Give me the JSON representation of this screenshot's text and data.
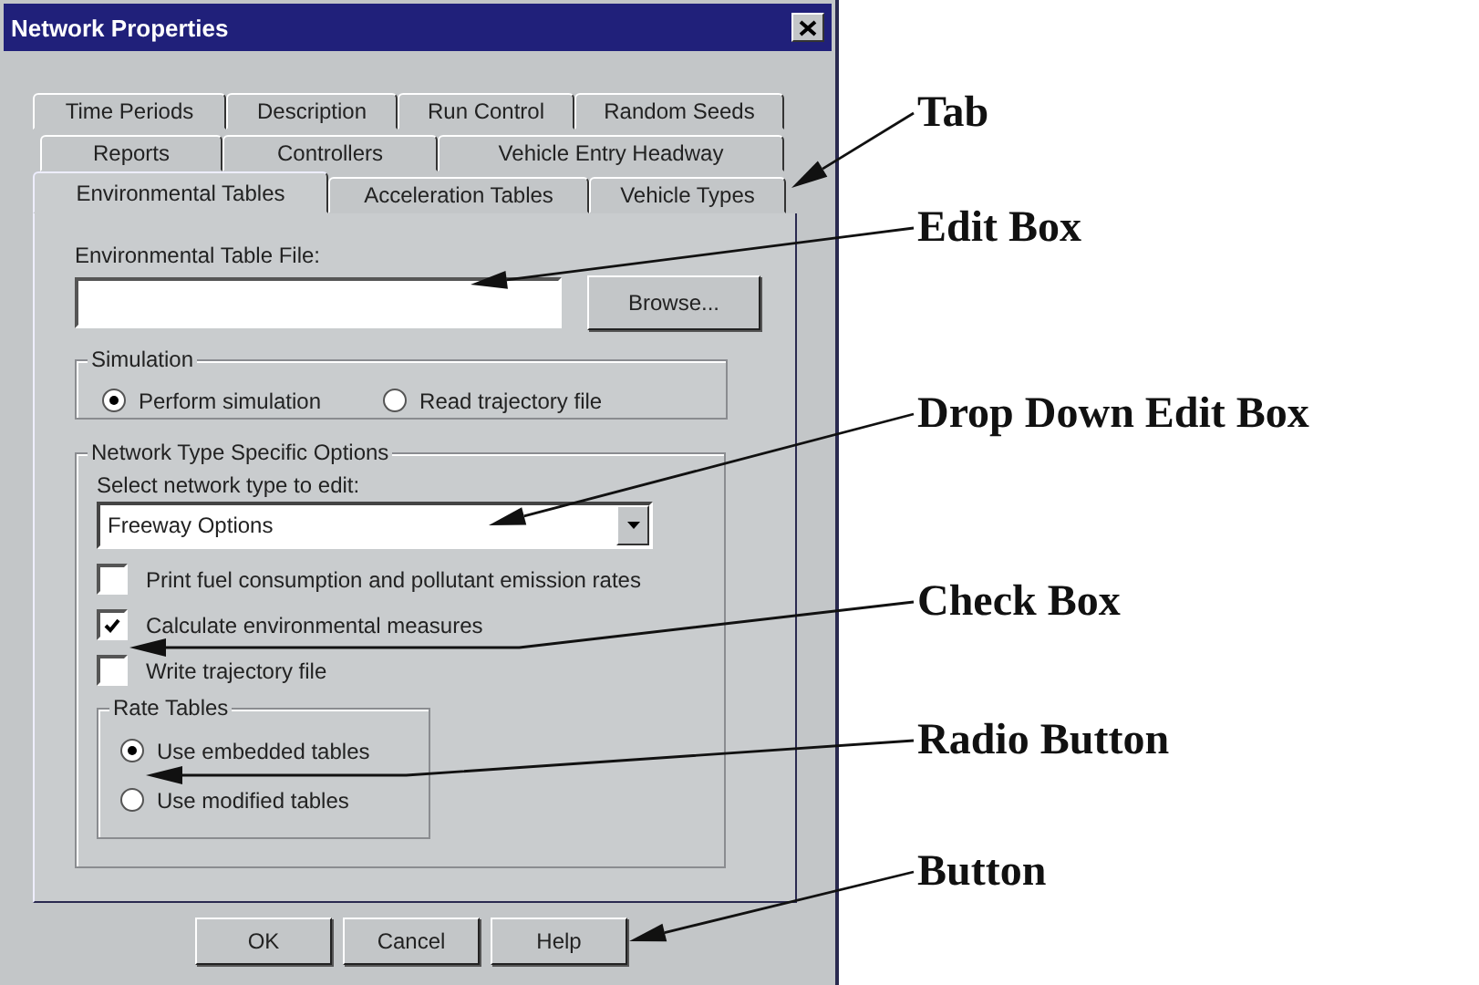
{
  "window": {
    "title": "Network Properties"
  },
  "tab_rows": [
    {
      "tabs": [
        {
          "label": "Time Periods",
          "selected": false
        },
        {
          "label": "Description",
          "selected": false
        },
        {
          "label": "Run Control",
          "selected": false
        },
        {
          "label": "Random Seeds",
          "selected": false
        }
      ]
    },
    {
      "tabs": [
        {
          "label": "Reports",
          "selected": false
        },
        {
          "label": "Controllers",
          "selected": false
        },
        {
          "label": "Vehicle Entry Headway",
          "selected": false
        }
      ]
    },
    {
      "tabs": [
        {
          "label": "Environmental Tables",
          "selected": true
        },
        {
          "label": "Acceleration Tables",
          "selected": false
        },
        {
          "label": "Vehicle Types",
          "selected": false
        }
      ]
    }
  ],
  "panel": {
    "file_label": "Environmental Table File:",
    "browse_button": "Browse...",
    "simulation": {
      "title": "Simulation",
      "options": [
        {
          "label": "Perform simulation",
          "selected": true
        },
        {
          "label": "Read trajectory file",
          "selected": false
        }
      ]
    },
    "network_options": {
      "title": "Network Type Specific Options",
      "select_label": "Select network type to edit:",
      "select_value": "Freeway Options",
      "checkboxes": [
        {
          "label": "Print fuel consumption and pollutant emission rates",
          "checked": false
        },
        {
          "label": "Calculate environmental measures",
          "checked": true
        },
        {
          "label": "Write trajectory file",
          "checked": false
        }
      ],
      "rate_tables": {
        "title": "Rate Tables",
        "options": [
          {
            "label": "Use embedded tables",
            "selected": true
          },
          {
            "label": "Use modified tables",
            "selected": false
          }
        ]
      }
    }
  },
  "buttons": [
    "OK",
    "Cancel",
    "Help"
  ],
  "annotations": [
    "Tab",
    "Edit Box",
    "Drop Down Edit Box",
    "Check Box",
    "Radio Button",
    "Button"
  ]
}
